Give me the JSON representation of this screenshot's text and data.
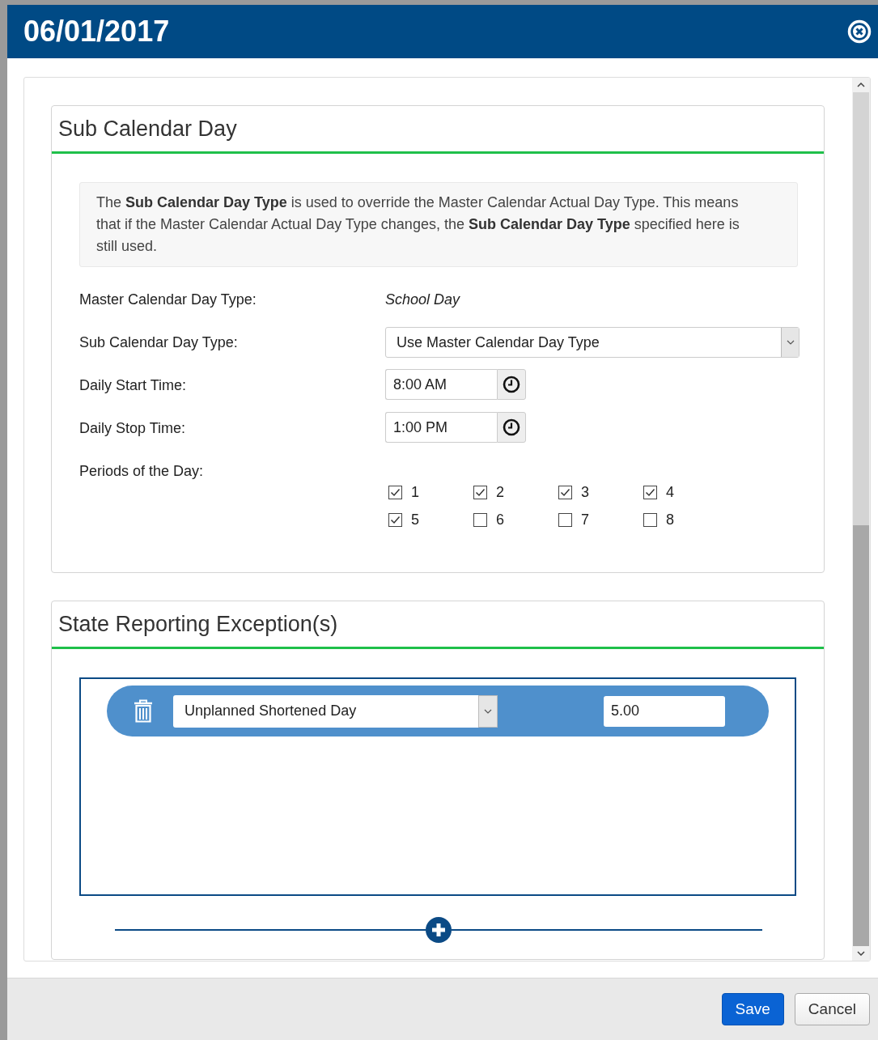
{
  "window": {
    "title": "06/01/2017"
  },
  "sub_calendar_day": {
    "title": "Sub Calendar Day",
    "info": "The **Sub Calendar Day Type** is used to override the Master Calendar Actual Day Type. This means that if the Master Calendar Actual Day Type changes, the **Sub Calendar Day Type** specified here is still used.",
    "fields": [
      {
        "kind": "static",
        "label": "Master Calendar Day Type:",
        "value": "School Day"
      },
      {
        "kind": "select",
        "label": "Sub Calendar Day Type:",
        "value": "Use Master Calendar Day Type"
      },
      {
        "kind": "time",
        "label": "Daily Start Time:",
        "value": "8:00 AM"
      },
      {
        "kind": "time",
        "label": "Daily Stop Time:",
        "value": "1:00 PM"
      },
      {
        "kind": "checks",
        "label": "Periods of the Day:",
        "options": [
          {
            "label": "1",
            "checked": true
          },
          {
            "label": "2",
            "checked": true
          },
          {
            "label": "3",
            "checked": true
          },
          {
            "label": "4",
            "checked": true
          },
          {
            "label": "5",
            "checked": true
          },
          {
            "label": "6",
            "checked": false
          },
          {
            "label": "7",
            "checked": false
          },
          {
            "label": "8",
            "checked": false
          }
        ]
      }
    ]
  },
  "state_reporting": {
    "title": "State Reporting Exception(s)",
    "exceptions": [
      {
        "type": "Unplanned Shortened Day",
        "value": "5.00"
      }
    ]
  },
  "buttons": [
    {
      "label": "Save",
      "kind": "primary"
    },
    {
      "label": "Cancel",
      "kind": "secondary"
    }
  ]
}
